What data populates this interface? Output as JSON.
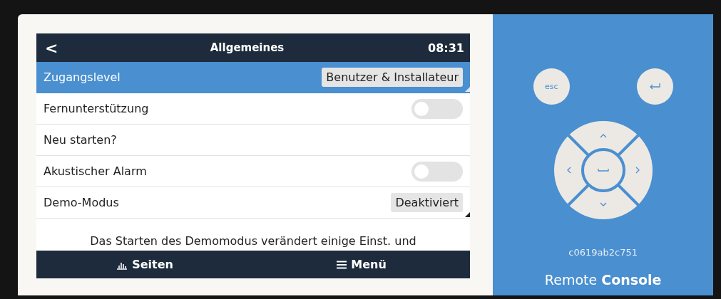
{
  "screen": {
    "back": "<",
    "title": "Allgemeines",
    "time": "08:31"
  },
  "rows": [
    {
      "kind": "select",
      "label": "Zugangslevel",
      "value": "Benutzer & Installateur",
      "selected": true
    },
    {
      "kind": "toggle",
      "label": "Fernunterstützung",
      "on": false,
      "selected": false
    },
    {
      "kind": "plain",
      "label": "Neu starten?",
      "selected": false
    },
    {
      "kind": "toggle",
      "label": "Akustischer Alarm",
      "on": false,
      "selected": false
    },
    {
      "kind": "select",
      "label": "Demo-Modus",
      "value": "Deaktiviert",
      "selected": false
    }
  ],
  "note": "Das Starten des Demomodus verändert einige Einst. und",
  "footer": [
    {
      "kind": "pages",
      "label": "Seiten"
    },
    {
      "kind": "menu",
      "label": "Menü"
    }
  ],
  "remote": {
    "esc": "esc",
    "device_id": "c0619ab2c751",
    "brand": "Remote **Console**"
  }
}
